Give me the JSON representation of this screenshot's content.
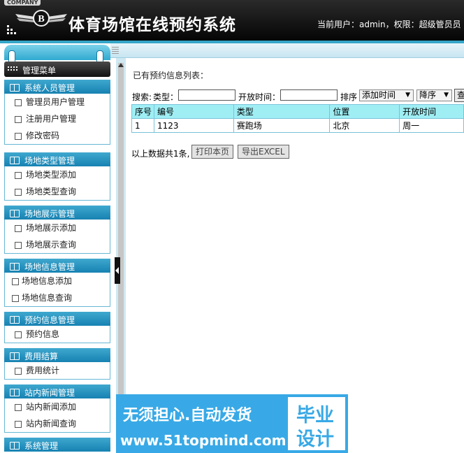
{
  "header": {
    "company": "COMPANY",
    "title": "体育场馆在线预约系统",
    "current_user": "当前用户：admin，权限：超级管员员"
  },
  "sidebar": {
    "menu_title": "管理菜单",
    "groups": [
      {
        "title": "系统人员管理",
        "items": [
          "管理员用户管理",
          "注册用户管理",
          "修改密码"
        ]
      },
      {
        "title": "场地类型管理",
        "items": [
          "场地类型添加",
          "场地类型查询"
        ]
      },
      {
        "title": "场地展示管理",
        "items": [
          "场地展示添加",
          "场地展示查询"
        ]
      },
      {
        "title": "场地信息管理",
        "items": [
          "场地信息添加",
          "场地信息查询"
        ]
      },
      {
        "title": "预约信息管理",
        "items": [
          "预约信息"
        ]
      },
      {
        "title": "费用结算",
        "items": [
          "费用统计"
        ]
      },
      {
        "title": "站内新闻管理",
        "items": [
          "站内新闻添加",
          "站内新闻查询"
        ]
      },
      {
        "title": "系统管理",
        "items": []
      }
    ]
  },
  "main": {
    "title": "已有预约信息列表：",
    "search": {
      "label": "搜索:",
      "type_label": "类型：",
      "type_value": "",
      "open_time_label": "开放时间：",
      "open_time_value": "",
      "sort_label": "排序",
      "sort_field": "添加时间",
      "sort_order": "降序",
      "query_button": "查询"
    },
    "table": {
      "headers": [
        "序号",
        "编号",
        "类型",
        "位置",
        "开放时间"
      ],
      "rows": [
        [
          "1",
          "1123",
          "赛跑场",
          "北京",
          "周一"
        ]
      ]
    },
    "footer": {
      "summary": "以上数据共1条,",
      "print_button": "打印本页",
      "export_button": "导出EXCEL"
    }
  },
  "watermark": {
    "line1": "无须担心.自动发货",
    "line2": "www.51topmind.com",
    "box_top": "毕业",
    "box_bottom": "设计"
  },
  "colors": {
    "header_bg": "#111111",
    "accent": "#35a6c8",
    "group_header": "#1f8fbe",
    "table_header": "#9feef4",
    "table_border": "#78c3da",
    "watermark_bg": "#38a9e6"
  }
}
